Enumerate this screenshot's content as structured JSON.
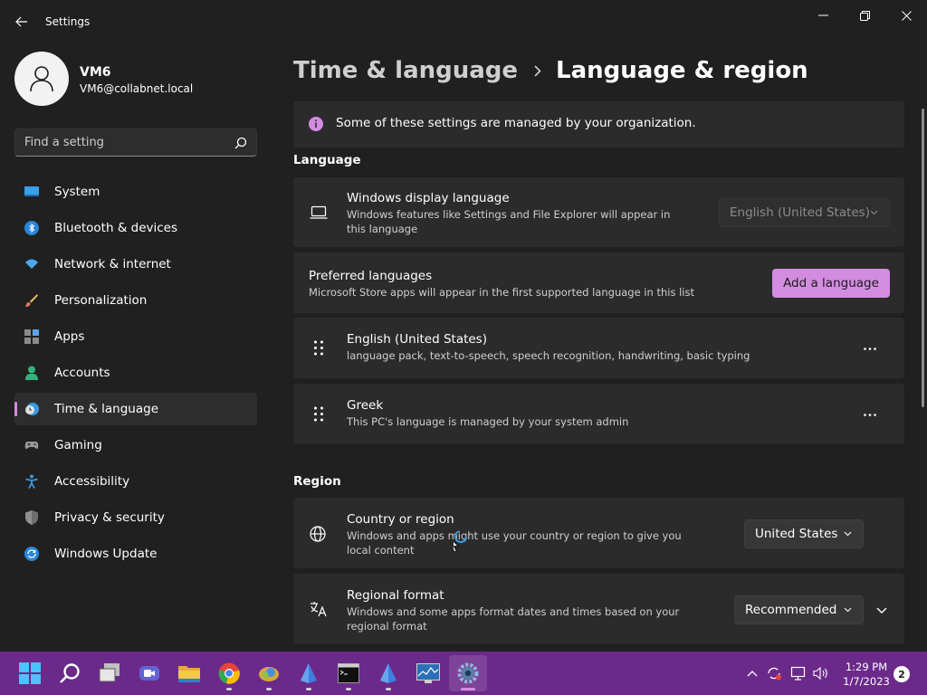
{
  "window": {
    "title": "Settings",
    "back_icon": "back-arrow-icon",
    "minimize_icon": "minimize-icon",
    "maximize_icon": "restore-icon",
    "close_icon": "close-icon"
  },
  "profile": {
    "name": "VM6",
    "email": "VM6@collabnet.local",
    "avatar_icon": "user-avatar-icon"
  },
  "search": {
    "placeholder": "Find a setting",
    "icon": "search-icon"
  },
  "sidebar": {
    "items": [
      {
        "label": "System",
        "icon": "system-icon"
      },
      {
        "label": "Bluetooth & devices",
        "icon": "bluetooth-icon"
      },
      {
        "label": "Network & internet",
        "icon": "wifi-icon"
      },
      {
        "label": "Personalization",
        "icon": "brush-icon"
      },
      {
        "label": "Apps",
        "icon": "apps-icon"
      },
      {
        "label": "Accounts",
        "icon": "accounts-icon"
      },
      {
        "label": "Time & language",
        "icon": "time-language-icon",
        "selected": true
      },
      {
        "label": "Gaming",
        "icon": "gaming-icon"
      },
      {
        "label": "Accessibility",
        "icon": "accessibility-icon"
      },
      {
        "label": "Privacy & security",
        "icon": "shield-icon"
      },
      {
        "label": "Windows Update",
        "icon": "windows-update-icon"
      }
    ]
  },
  "breadcrumb": {
    "parent": "Time & language",
    "current": "Language & region"
  },
  "info_bar": {
    "text": "Some of these settings are managed by your organization.",
    "icon": "info-icon"
  },
  "language": {
    "section_title": "Language",
    "display_language": {
      "title": "Windows display language",
      "description": "Windows features like Settings and File Explorer will appear in this language",
      "value": "English (United States)",
      "icon": "laptop-icon",
      "disabled": true
    },
    "preferred": {
      "title": "Preferred languages",
      "description": "Microsoft Store apps will appear in the first supported language in this list",
      "add_button": "Add a language"
    },
    "languages": [
      {
        "name": "English (United States)",
        "detail": "language pack, text-to-speech, speech recognition, handwriting, basic typing"
      },
      {
        "name": "Greek",
        "detail": "This PC's language is managed by your system admin"
      }
    ]
  },
  "region": {
    "section_title": "Region",
    "country": {
      "title": "Country or region",
      "description": "Windows and apps might use your country or region to give you local content",
      "value": "United States",
      "icon": "globe-icon"
    },
    "format": {
      "title": "Regional format",
      "description": "Windows and some apps format dates and times based on your regional format",
      "value": "Recommended",
      "icon": "regional-format-icon"
    }
  },
  "taskbar": {
    "apps": [
      "start-icon",
      "search-icon",
      "task-view-icon",
      "teams-chat-icon",
      "file-explorer-icon",
      "chrome-icon",
      "pinned-app-icon",
      "pinned-app-icon",
      "terminal-icon",
      "pinned-app-icon",
      "monitor-icon",
      "settings-icon"
    ],
    "time": "1:29 PM",
    "date": "1/7/2023",
    "notifications": "2"
  },
  "colors": {
    "accent": "#d48ce0",
    "background": "#202020",
    "card": "#2b2b2b",
    "taskbar": "#6b2a8a"
  }
}
